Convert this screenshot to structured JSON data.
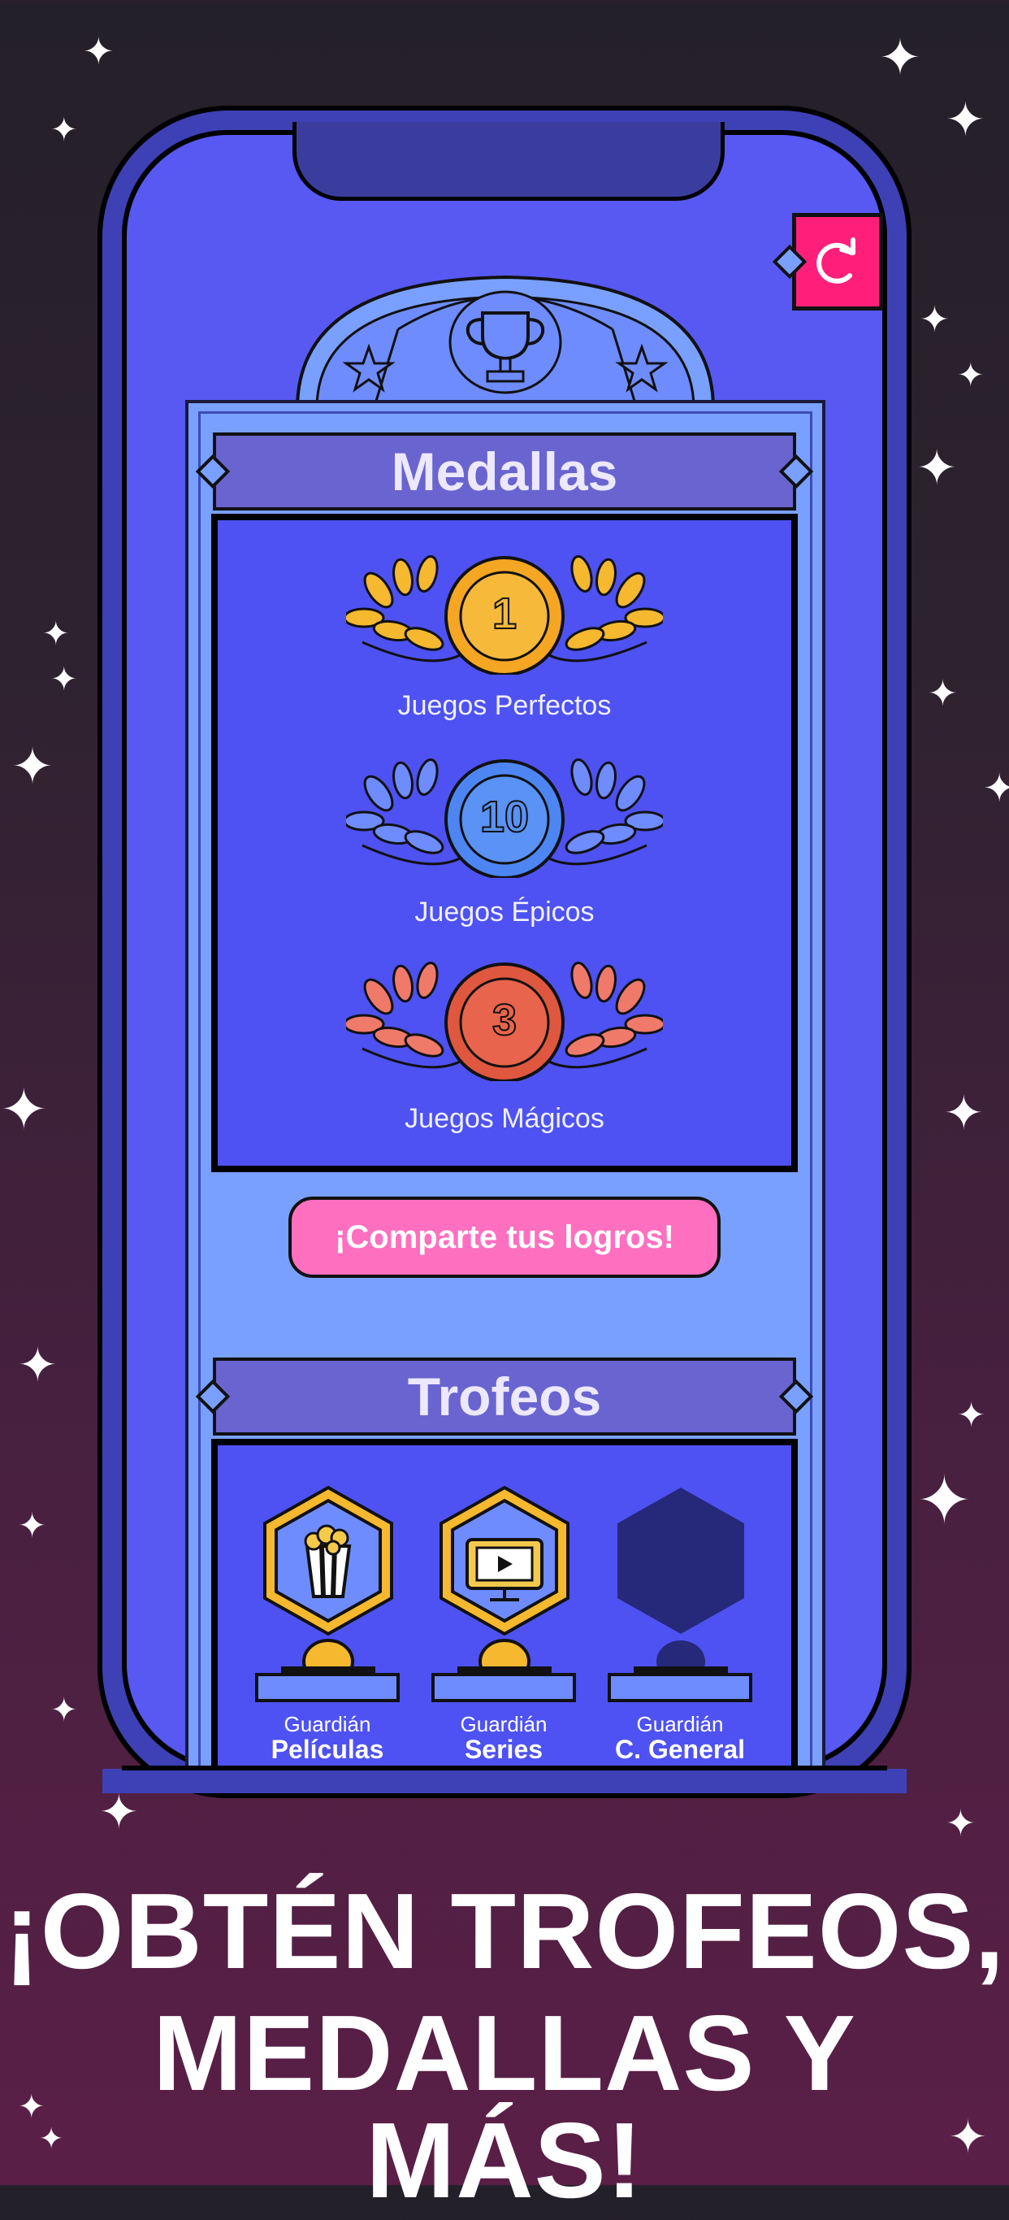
{
  "medals_section": {
    "title": "Medallas",
    "items": [
      {
        "count": "1",
        "label": "Juegos Perfectos",
        "color": "#f5a623"
      },
      {
        "count": "10",
        "label": "Juegos Épicos",
        "color": "#4d86f2"
      },
      {
        "count": "3",
        "label": "Juegos Mágicos",
        "color": "#e0573f"
      }
    ]
  },
  "share_button": {
    "label": "¡Comparte tus logros!"
  },
  "trophies_section": {
    "title": "Trofeos",
    "items": [
      {
        "caption": "Guardián",
        "name": "Películas",
        "icon": "popcorn-icon",
        "unlocked": true
      },
      {
        "caption": "Guardián",
        "name": "Series",
        "icon": "tv-play-icon",
        "unlocked": true
      },
      {
        "caption": "Guardián",
        "name": "C. General",
        "icon": "locked-hexagon-icon",
        "unlocked": false
      }
    ]
  },
  "headline": {
    "line1": "¡OBTÉN TROFEOS,",
    "line2": "MEDALLAS Y MÁS!"
  },
  "colors": {
    "accent_pink": "#ff1f7a",
    "board_blue": "#7aa0ff",
    "panel_blue": "#4e52f2",
    "gold": "#f5b82e"
  }
}
